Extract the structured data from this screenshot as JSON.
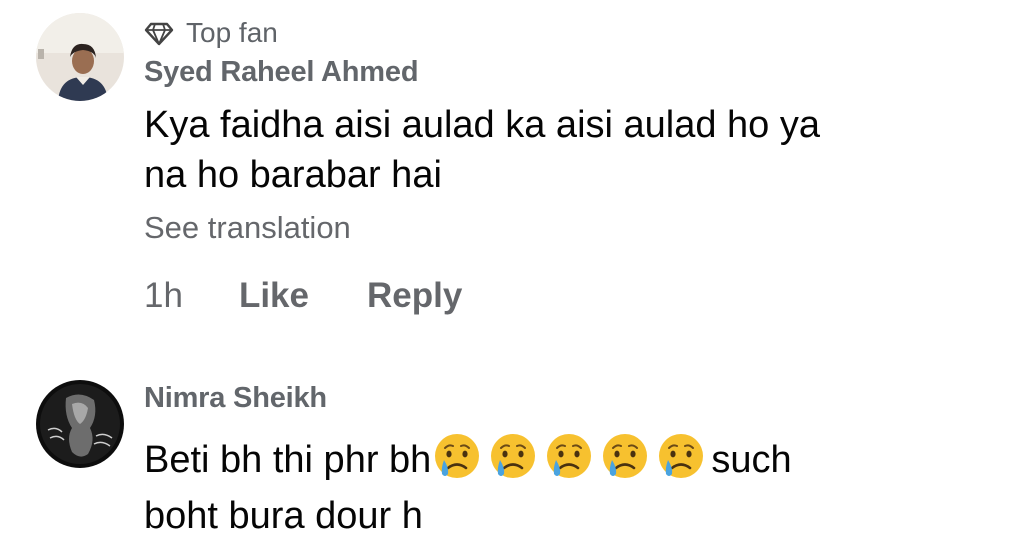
{
  "comments": [
    {
      "badge": "Top fan",
      "badge_icon": "diamond-icon",
      "author": "Syed Raheel Ahmed",
      "text_line1": "Kya faidha aisi aulad ka aisi aulad ho ya",
      "text_line2": "na ho barabar hai",
      "translate_label": "See translation",
      "time": "1h",
      "like_label": "Like",
      "reply_label": "Reply"
    },
    {
      "author": "Nimra Sheikh",
      "text_part1": "Beti bh thi phr bh",
      "emoji": "sad-but-relieved-face",
      "emoji_count": 5,
      "text_part2": "such",
      "text_line2": "boht bura dour h"
    }
  ],
  "colors": {
    "text": "#050505",
    "secondary": "#65676b",
    "author": "#62666b",
    "emoji_face": "#f7c12f",
    "emoji_tear": "#4aa3df"
  }
}
